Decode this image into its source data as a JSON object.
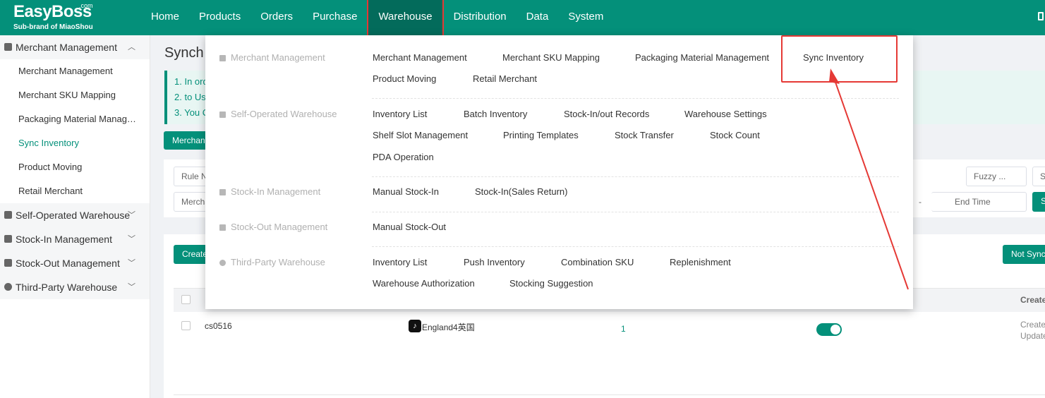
{
  "brand": {
    "name": "EasyBoss",
    "com": ".com",
    "sub": "Sub-brand of MiaoShou"
  },
  "nav": [
    {
      "label": "Home"
    },
    {
      "label": "Products"
    },
    {
      "label": "Orders"
    },
    {
      "label": "Purchase"
    },
    {
      "label": "Warehouse",
      "active": true
    },
    {
      "label": "Distribution"
    },
    {
      "label": "Data"
    },
    {
      "label": "System"
    }
  ],
  "sidebar": {
    "merchant_group": "Merchant Management",
    "merchant_items": [
      "Merchant Management",
      "Merchant SKU Mapping",
      "Packaging Material Manage…",
      "Sync Inventory",
      "Product Moving",
      "Retail Merchant"
    ],
    "active_item": "Sync Inventory",
    "groups": [
      "Self-Operated Warehouse",
      "Stock-In Management",
      "Stock-Out Management",
      "Third-Party Warehouse"
    ]
  },
  "page": {
    "title": "Synch",
    "notice": [
      "1. In ord",
      "2. to Use",
      "3. You C"
    ],
    "tab": "Merchan",
    "filter": {
      "rule": "Rule N",
      "merchant": "Mercha",
      "fuzzy": "Fuzzy ...",
      "s1": "S",
      "dash": "-",
      "end_time": "End Time",
      "s2": "S"
    },
    "create_btn": "Create",
    "not_sync_btn": "Not Sync",
    "table": {
      "header_right": "Create",
      "row": {
        "id": "cs0516",
        "store": "England4英国",
        "count": "1",
        "create": "Create",
        "update": "Update"
      }
    }
  },
  "dropdown": {
    "sections": [
      {
        "category": "Merchant Management",
        "links": [
          [
            "Merchant Management",
            "Merchant SKU Mapping",
            "Packaging Material Management",
            "Sync Inventory"
          ],
          [
            "Product Moving",
            "Retail Merchant"
          ]
        ]
      },
      {
        "category": "Self-Operated Warehouse",
        "links": [
          [
            "Inventory List",
            "Batch Inventory",
            "Stock-In/out Records",
            "Warehouse Settings"
          ],
          [
            "Shelf Slot Management",
            "Printing Templates",
            "Stock Transfer",
            "Stock Count"
          ],
          [
            "PDA Operation"
          ]
        ]
      },
      {
        "category": "Stock-In Management",
        "links": [
          [
            "Manual Stock-In",
            "Stock-In(Sales Return)"
          ]
        ]
      },
      {
        "category": "Stock-Out Management",
        "links": [
          [
            "Manual Stock-Out"
          ]
        ]
      },
      {
        "category": "Third-Party Warehouse",
        "links": [
          [
            "Inventory List",
            "Push Inventory",
            "Combination SKU",
            "Replenishment"
          ],
          [
            "Warehouse Authorization",
            "Stocking Suggestion"
          ]
        ]
      }
    ]
  },
  "colors": {
    "brand": "#04907a",
    "annotation": "#e53935"
  }
}
